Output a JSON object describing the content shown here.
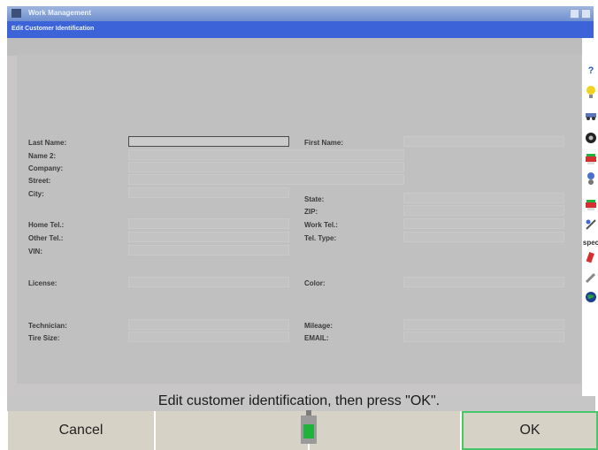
{
  "window": {
    "title": "Work Management",
    "subtitle": "Edit Customer Identification"
  },
  "form": {
    "fields": [
      {
        "label": "Last Name:",
        "value": ""
      },
      {
        "label": "First Name:",
        "value": ""
      },
      {
        "label": "Name 2:",
        "value": ""
      },
      {
        "label": "Company:",
        "value": ""
      },
      {
        "label": "Street:",
        "value": ""
      },
      {
        "label": "City:",
        "value": ""
      },
      {
        "label": "State:",
        "value": ""
      },
      {
        "label": "ZIP:",
        "value": ""
      },
      {
        "label": "Home Tel.:",
        "value": ""
      },
      {
        "label": "Work Tel.:",
        "value": ""
      },
      {
        "label": "Other Tel.:",
        "value": ""
      },
      {
        "label": "Tel. Type:",
        "value": ""
      },
      {
        "label": "VIN:",
        "value": ""
      },
      {
        "label": "License:",
        "value": ""
      },
      {
        "label": "Color:",
        "value": ""
      },
      {
        "label": "Technician:",
        "value": ""
      },
      {
        "label": "Mileage:",
        "value": ""
      },
      {
        "label": "Tire Size:",
        "value": ""
      },
      {
        "label": "EMAIL:",
        "value": ""
      }
    ]
  },
  "sidebar": {
    "icons": [
      "help-icon",
      "lightbulb-icon",
      "vehicle-icon",
      "tire-icon",
      "printer-icon",
      "settings-icon",
      "printer-icon",
      "tools-icon",
      "spec-icon",
      "wrench-icon",
      "globe-icon"
    ]
  },
  "prompt": "Edit customer identification, then press \"OK\".",
  "buttons": {
    "cancel": "Cancel",
    "ok": "OK"
  },
  "colors": {
    "titlebar": "#7c97d3",
    "subtitle_bar": "#3c64d8",
    "panel": "#c0c0c0",
    "ok_border": "#48c66a",
    "gauge_fill": "#1eb33a"
  }
}
